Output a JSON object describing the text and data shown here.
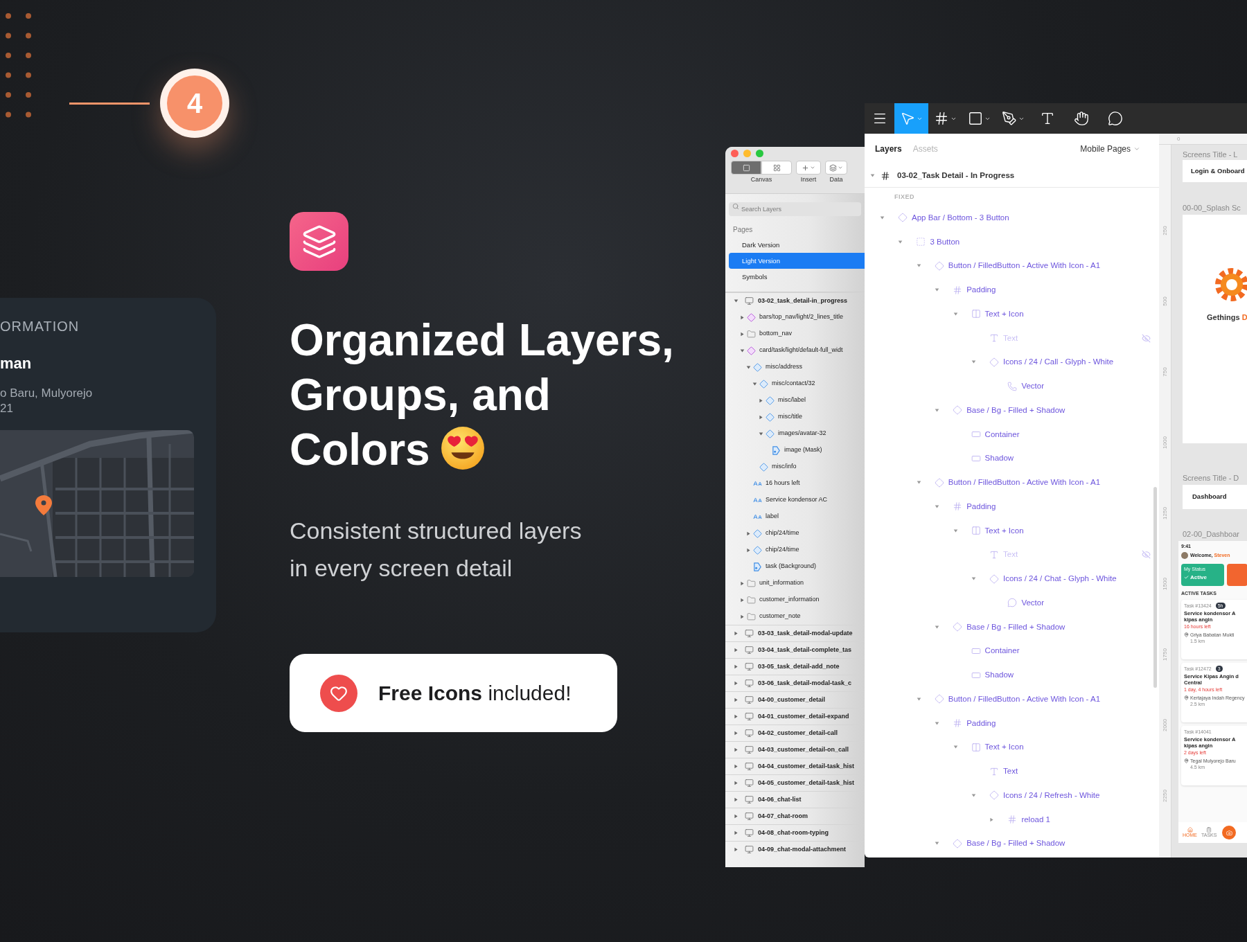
{
  "step": {
    "number": "4"
  },
  "info_card": {
    "heading": "ORMATION",
    "name": "man",
    "address_lines": [
      "o Baru, Mulyorejo",
      "21"
    ]
  },
  "hero": {
    "title_lines": [
      "Organized Layers,",
      "Groups, and",
      "Colors"
    ],
    "subtitle_lines": [
      "Consistent structured layers",
      "in every screen detail"
    ],
    "cta": "**Free Icons** included!"
  },
  "sketch": {
    "toolbar": [
      {
        "label": "Canvas",
        "kind": "view",
        "segments": [
          {
            "selected": true
          },
          {
            "selected": false
          }
        ]
      },
      {
        "label": "Insert",
        "kind": "insert"
      },
      {
        "label": "Data",
        "kind": "data"
      }
    ],
    "search": {
      "placeholder": "Search Layers"
    },
    "pages_heading": "Pages",
    "pages": [
      {
        "label": "Dark Version",
        "selected": false
      },
      {
        "label": "Light Version",
        "selected": true
      },
      {
        "label": "Symbols",
        "selected": false
      }
    ],
    "layers": [
      {
        "name": "03-02_task_detail-in_progress",
        "kind": "artboard",
        "expanded": true,
        "children": [
          {
            "name": "bars/top_nav/light/2_lines_title",
            "kind": "symbol",
            "expanded": false
          },
          {
            "name": "bottom_nav",
            "kind": "folder",
            "expanded": false
          },
          {
            "name": "card/task/light/default-full_widt",
            "kind": "symbol",
            "expanded": true,
            "children": [
              {
                "name": "misc/address",
                "kind": "instance",
                "expanded": true,
                "children": [
                  {
                    "name": "misc/contact/32",
                    "kind": "instance",
                    "expanded": true,
                    "children": [
                      {
                        "name": "misc/label",
                        "kind": "instance",
                        "expanded": false
                      },
                      {
                        "name": "misc/title",
                        "kind": "instance",
                        "expanded": false
                      },
                      {
                        "name": "images/avatar-32",
                        "kind": "instance",
                        "expanded": true,
                        "children": [
                          {
                            "name": "image (Mask)",
                            "kind": "mask"
                          }
                        ]
                      }
                    ]
                  },
                  {
                    "name": "misc/info",
                    "kind": "instance"
                  }
                ]
              },
              {
                "name": "16 hours left",
                "kind": "text"
              },
              {
                "name": "Service kondensor AC",
                "kind": "text"
              },
              {
                "name": "label",
                "kind": "text"
              },
              {
                "name": "chip/24/time",
                "kind": "instance",
                "expanded": false
              },
              {
                "name": "chip/24/time",
                "kind": "instance",
                "expanded": false
              },
              {
                "name": "task (Background)",
                "kind": "mask"
              }
            ]
          },
          {
            "name": "unit_information",
            "kind": "folder",
            "expanded": false
          },
          {
            "name": "customer_information",
            "kind": "folder",
            "expanded": false
          },
          {
            "name": "customer_note",
            "kind": "folder",
            "expanded": false
          }
        ]
      },
      {
        "name": "03-03_task_detail-modal-update",
        "kind": "artboard",
        "expanded": false
      },
      {
        "name": "03-04_task_detail-complete_tas",
        "kind": "artboard",
        "expanded": false
      },
      {
        "name": "03-05_task_detail-add_note",
        "kind": "artboard",
        "expanded": false
      },
      {
        "name": "03-06_task_detail-modal-task_c",
        "kind": "artboard",
        "expanded": false
      },
      {
        "name": "04-00_customer_detail",
        "kind": "artboard",
        "expanded": false
      },
      {
        "name": "04-01_customer_detail-expand",
        "kind": "artboard",
        "expanded": false
      },
      {
        "name": "04-02_customer_detail-call",
        "kind": "artboard",
        "expanded": false
      },
      {
        "name": "04-03_customer_detail-on_call",
        "kind": "artboard",
        "expanded": false
      },
      {
        "name": "04-04_customer_detail-task_hist",
        "kind": "artboard",
        "expanded": false
      },
      {
        "name": "04-05_customer_detail-task_hist",
        "kind": "artboard",
        "expanded": false
      },
      {
        "name": "04-06_chat-list",
        "kind": "artboard",
        "expanded": false
      },
      {
        "name": "04-07_chat-room",
        "kind": "artboard",
        "expanded": false
      },
      {
        "name": "04-08_chat-room-typing",
        "kind": "artboard",
        "expanded": false
      },
      {
        "name": "04-09_chat-modal-attachment",
        "kind": "artboard",
        "expanded": false
      }
    ]
  },
  "figma": {
    "tools": [
      {
        "kind": "menu",
        "selected": false
      },
      {
        "kind": "move",
        "selected": true
      },
      {
        "kind": "frame",
        "selected": false
      },
      {
        "kind": "shape",
        "selected": false
      },
      {
        "kind": "pen",
        "selected": false
      },
      {
        "kind": "text",
        "selected": false
      },
      {
        "kind": "hand",
        "selected": false
      },
      {
        "kind": "comment",
        "selected": false
      }
    ],
    "tabs": [
      {
        "label": "Layers",
        "selected": true
      },
      {
        "label": "Assets",
        "selected": false
      }
    ],
    "page_menu": "Mobile Pages",
    "root": "03-02_Task Detail - In Progress",
    "section": "FIXED",
    "layers": [
      {
        "name": "App Bar / Bottom - 3 Button",
        "kind": "component",
        "expanded": true,
        "children": [
          {
            "name": "3 Button",
            "kind": "group",
            "expanded": true,
            "children": [
              {
                "name": "Button / FilledButton - Active With Icon - A1",
                "kind": "component",
                "expanded": true,
                "children": [
                  {
                    "name": "Padding",
                    "kind": "frame",
                    "expanded": true,
                    "children": [
                      {
                        "name": "Text + Icon",
                        "kind": "autolayout",
                        "expanded": true,
                        "children": [
                          {
                            "name": "Text",
                            "kind": "text",
                            "hidden": true
                          },
                          {
                            "name": "Icons / 24 / Call - Glyph - White",
                            "kind": "component",
                            "expanded": true,
                            "children": [
                              {
                                "name": "Vector",
                                "kind": "phone"
                              }
                            ]
                          }
                        ]
                      }
                    ]
                  },
                  {
                    "name": "Base / Bg - Filled + Shadow",
                    "kind": "component",
                    "expanded": true,
                    "children": [
                      {
                        "name": "Container",
                        "kind": "rect"
                      },
                      {
                        "name": "Shadow",
                        "kind": "rect"
                      }
                    ]
                  }
                ]
              },
              {
                "name": "Button / FilledButton - Active With Icon - A1",
                "kind": "component",
                "expanded": true,
                "children": [
                  {
                    "name": "Padding",
                    "kind": "frame",
                    "expanded": true,
                    "children": [
                      {
                        "name": "Text + Icon",
                        "kind": "autolayout",
                        "expanded": true,
                        "children": [
                          {
                            "name": "Text",
                            "kind": "text",
                            "hidden": true
                          },
                          {
                            "name": "Icons / 24 / Chat - Glyph - White",
                            "kind": "component",
                            "expanded": true,
                            "children": [
                              {
                                "name": "Vector",
                                "kind": "chat"
                              }
                            ]
                          }
                        ]
                      }
                    ]
                  },
                  {
                    "name": "Base / Bg - Filled + Shadow",
                    "kind": "component",
                    "expanded": true,
                    "children": [
                      {
                        "name": "Container",
                        "kind": "rect"
                      },
                      {
                        "name": "Shadow",
                        "kind": "rect"
                      }
                    ]
                  }
                ]
              },
              {
                "name": "Button / FilledButton - Active With Icon - A1",
                "kind": "component",
                "expanded": true,
                "children": [
                  {
                    "name": "Padding",
                    "kind": "frame",
                    "expanded": true,
                    "children": [
                      {
                        "name": "Text + Icon",
                        "kind": "autolayout",
                        "expanded": true,
                        "children": [
                          {
                            "name": "Text",
                            "kind": "text",
                            "hidden": false
                          },
                          {
                            "name": "Icons / 24 / Refresh - White",
                            "kind": "component",
                            "expanded": true,
                            "children": [
                              {
                                "name": "reload 1",
                                "kind": "frame",
                                "expanded": false
                              }
                            ]
                          }
                        ]
                      }
                    ]
                  },
                  {
                    "name": "Base / Bg - Filled + Shadow",
                    "kind": "component",
                    "expanded": true
                  }
                ]
              }
            ]
          }
        ]
      }
    ]
  },
  "canvas": {
    "x_ruler_mark": "0",
    "y_ruler_marks": [
      "250",
      "500",
      "750",
      "1000",
      "1250",
      "1500",
      "1750",
      "2000",
      "2250"
    ],
    "login_group": {
      "label": "Screens Title - L",
      "card_title": "Login & Onboard"
    },
    "splash": {
      "label": "00-00_Splash Sc",
      "brand": "Gethings",
      "brand_tail": "D"
    },
    "dashboard_group": {
      "label": "Screens Title - D",
      "card_title": "Dashboard"
    },
    "dashboard": {
      "label": "02-00_Dashboar",
      "time": "9:41",
      "greeting": "Welcome, ",
      "user": "Steven",
      "status_label": "My Status",
      "status": "Active",
      "section": "ACTIVE TASKS",
      "tasks": [
        {
          "id": "Task #13424",
          "badge": "5h",
          "title_lines": [
            "Service kondensor A",
            "kipas angin"
          ],
          "due": "16 hours left",
          "place": "Griya Babatan Mukti",
          "distance": "1.5 km"
        },
        {
          "id": "Task #12472",
          "badge": "3",
          "title_lines": [
            "Service Kipas Angin d",
            "Central"
          ],
          "due": "1 day, 4 hours left",
          "place": "Kertajaya Indah Regency",
          "distance": "2.5 km"
        },
        {
          "id": "Task #14041",
          "title_lines": [
            "Service kondensor A",
            "kipas angin"
          ],
          "due": "2 days left",
          "place": "Tegal Mulyorejo Baru",
          "distance": "4.5 km"
        }
      ],
      "nav": [
        {
          "label": "HOME",
          "selected": true
        },
        {
          "label": "TASKS",
          "selected": false
        }
      ]
    }
  }
}
